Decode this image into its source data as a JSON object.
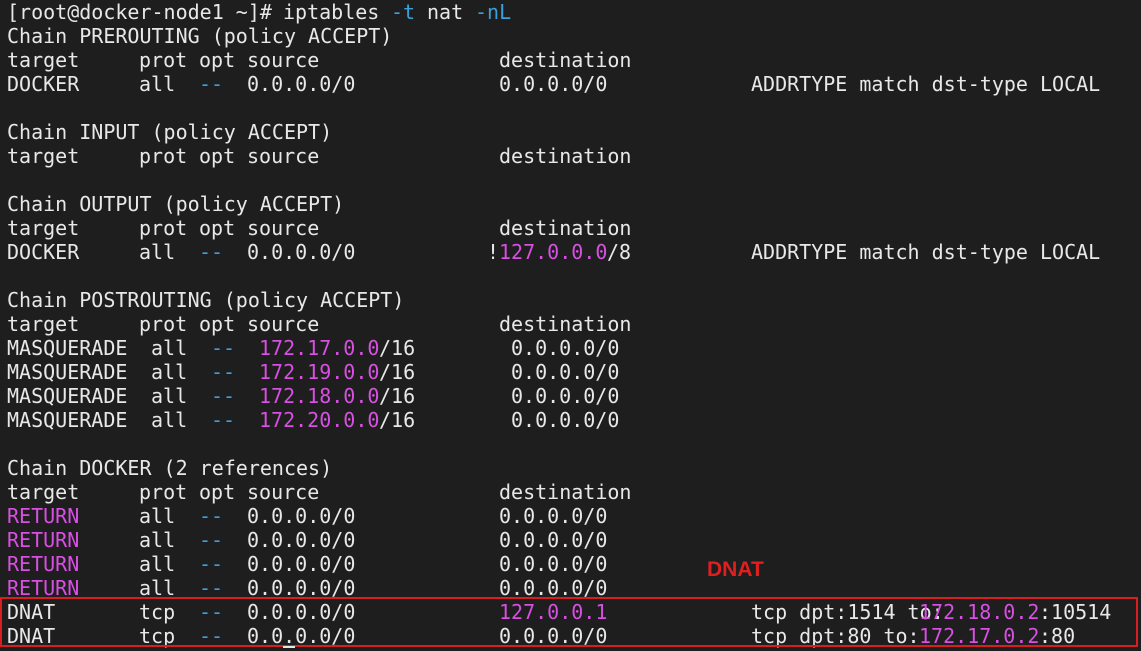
{
  "terminal": {
    "prompt": "[root@docker-node1 ~]# ",
    "command": "iptables",
    "flag_t": "-t",
    "table": "nat",
    "flag_nL": "-nL"
  },
  "chains": {
    "prerouting": {
      "title": "Chain PREROUTING (policy ACCEPT)",
      "h_target": "target",
      "h_prot": "prot",
      "h_opt": "opt",
      "h_source": "source",
      "h_destination": "destination",
      "r0": {
        "target": "DOCKER",
        "prot": "all",
        "opt": "--",
        "source": "0.0.0.0/0",
        "destination": "0.0.0.0/0",
        "extra": "ADDRTYPE match dst-type LOCAL"
      }
    },
    "input": {
      "title": "Chain INPUT (policy ACCEPT)",
      "h_target": "target",
      "h_prot": "prot",
      "h_opt": "opt",
      "h_source": "source",
      "h_destination": "destination"
    },
    "output": {
      "title": "Chain OUTPUT (policy ACCEPT)",
      "h_target": "target",
      "h_prot": "prot",
      "h_opt": "opt",
      "h_source": "source",
      "h_destination": "destination",
      "r0": {
        "target": "DOCKER",
        "prot": "all",
        "opt": "--",
        "source": "0.0.0.0/0",
        "dest_not": "!",
        "dest_ip": "127.0.0.0",
        "dest_mask": "/8",
        "extra": "ADDRTYPE match dst-type LOCAL"
      }
    },
    "postrouting": {
      "title": "Chain POSTROUTING (policy ACCEPT)",
      "h_target": "target",
      "h_prot": "prot",
      "h_opt": "opt",
      "h_source": "source",
      "h_destination": "destination",
      "r0": {
        "target": "MASQUERADE",
        "prot": "all",
        "opt": "--",
        "src_ip": "172.17.0.0",
        "src_mask": "/16",
        "destination": "0.0.0.0/0"
      },
      "r1": {
        "target": "MASQUERADE",
        "prot": "all",
        "opt": "--",
        "src_ip": "172.19.0.0",
        "src_mask": "/16",
        "destination": "0.0.0.0/0"
      },
      "r2": {
        "target": "MASQUERADE",
        "prot": "all",
        "opt": "--",
        "src_ip": "172.18.0.0",
        "src_mask": "/16",
        "destination": "0.0.0.0/0"
      },
      "r3": {
        "target": "MASQUERADE",
        "prot": "all",
        "opt": "--",
        "src_ip": "172.20.0.0",
        "src_mask": "/16",
        "destination": "0.0.0.0/0"
      }
    },
    "docker": {
      "title": "Chain DOCKER (2 references)",
      "h_target": "target",
      "h_prot": "prot",
      "h_opt": "opt",
      "h_source": "source",
      "h_destination": "destination",
      "r0": {
        "target": "RETURN",
        "prot": "all",
        "opt": "--",
        "source": "0.0.0.0/0",
        "destination": "0.0.0.0/0"
      },
      "r1": {
        "target": "RETURN",
        "prot": "all",
        "opt": "--",
        "source": "0.0.0.0/0",
        "destination": "0.0.0.0/0"
      },
      "r2": {
        "target": "RETURN",
        "prot": "all",
        "opt": "--",
        "source": "0.0.0.0/0",
        "destination": "0.0.0.0/0"
      },
      "r3": {
        "target": "RETURN",
        "prot": "all",
        "opt": "--",
        "source": "0.0.0.0/0",
        "destination": "0.0.0.0/0"
      },
      "r4": {
        "target": "DNAT",
        "prot": "tcp",
        "opt": "--",
        "source": "0.0.0.0/0",
        "destination": "127.0.0.1",
        "rule_a": "tcp dpt:1514 to:",
        "rule_ip": "172.18.0.2",
        "rule_b": ":10514"
      },
      "r5": {
        "target": "DNAT",
        "prot": "tcp",
        "opt": "--",
        "source": "0.0.0.0/0",
        "destination": "0.0.0.0/0",
        "rule_a": "tcp dpt:80 to:",
        "rule_ip": "172.17.0.2",
        "rule_b": ":80"
      }
    }
  },
  "annotation": {
    "label": "DNAT",
    "color": "#e01f1f"
  },
  "colors": {
    "background": "#1e1e1e",
    "text": "#e8e8e8",
    "option_blue": "#3aa0d8",
    "highlight_magenta": "#d94fe3",
    "annotation_red": "#e01f1f"
  }
}
